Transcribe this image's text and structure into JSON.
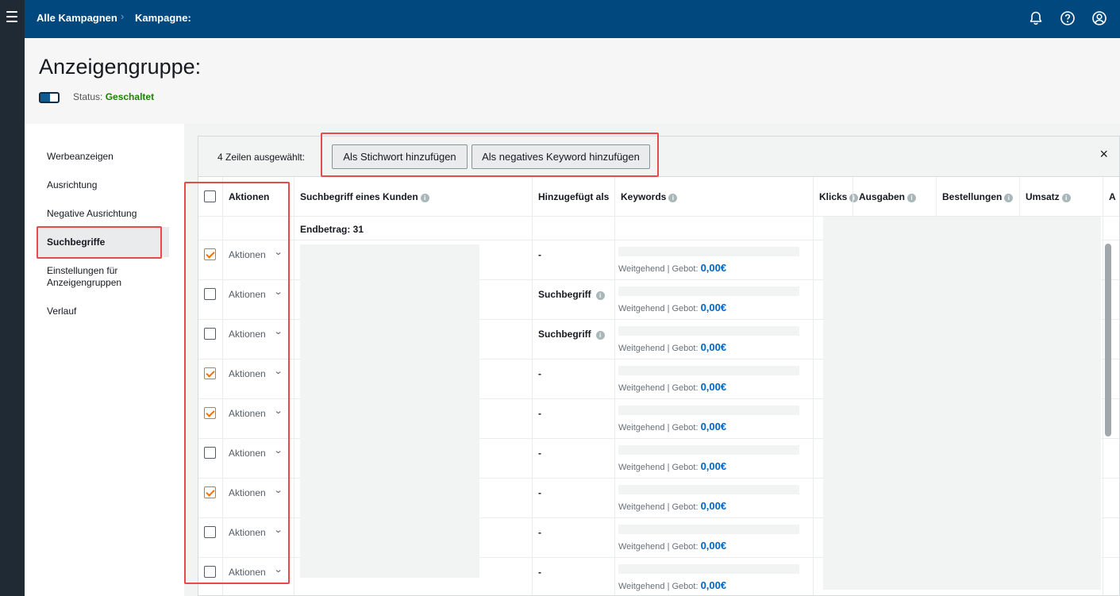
{
  "topbar": {
    "crumbs": [
      "Alle Kampagnen",
      "Kampagne:"
    ],
    "crumb_separator": "›",
    "icons": [
      "bell-icon",
      "help-icon",
      "user-icon"
    ],
    "bg_color": "#00487d"
  },
  "header": {
    "title": "Anzeigengruppe:",
    "status_label": "Status:",
    "status_value": "Geschaltet",
    "status_color": "#1d8102"
  },
  "nav": {
    "items": [
      {
        "label": "Werbeanzeigen",
        "active": false
      },
      {
        "label": "Ausrichtung",
        "active": false
      },
      {
        "label": "Negative Ausrichtung",
        "active": false
      },
      {
        "label": "Suchbegriffe",
        "active": true
      },
      {
        "label": "Einstellungen für Anzeigengruppen",
        "active": false
      },
      {
        "label": "Verlauf",
        "active": false
      }
    ]
  },
  "toolbar": {
    "selected_count": "4 Zeilen ausgewählt:",
    "add_keyword": "Als Stichwort hinzufügen",
    "add_negative": "Als negatives Keyword hinzufügen",
    "close": "×"
  },
  "table": {
    "headers": {
      "actions": "Aktionen",
      "search_term": "Suchbegriff eines Kunden",
      "added_as": "Hinzugefügt als",
      "keywords": "Keywords",
      "clicks": "Klicks",
      "spend": "Ausgaben",
      "orders": "Bestellungen",
      "sales": "Umsatz",
      "truncated": "A"
    },
    "total_label": "Endbetrag: 31",
    "rows": [
      {
        "checked": true,
        "actions": "Aktionen",
        "added_as": "-",
        "match": "Weitgehend | Gebot:",
        "bid": "0,00€"
      },
      {
        "checked": false,
        "actions": "Aktionen",
        "added_as": "Suchbegriff",
        "match": "Weitgehend | Gebot:",
        "bid": "0,00€"
      },
      {
        "checked": false,
        "actions": "Aktionen",
        "added_as": "Suchbegriff",
        "match": "Weitgehend | Gebot:",
        "bid": "0,00€"
      },
      {
        "checked": true,
        "actions": "Aktionen",
        "added_as": "-",
        "match": "Weitgehend | Gebot:",
        "bid": "0,00€"
      },
      {
        "checked": true,
        "actions": "Aktionen",
        "added_as": "-",
        "match": "Weitgehend | Gebot:",
        "bid": "0,00€"
      },
      {
        "checked": false,
        "actions": "Aktionen",
        "added_as": "-",
        "match": "Weitgehend | Gebot:",
        "bid": "0,00€"
      },
      {
        "checked": true,
        "actions": "Aktionen",
        "added_as": "-",
        "match": "Weitgehend | Gebot:",
        "bid": "0,00€"
      },
      {
        "checked": false,
        "actions": "Aktionen",
        "added_as": "-",
        "match": "Weitgehend | Gebot:",
        "bid": "0,00€"
      },
      {
        "checked": false,
        "actions": "Aktionen",
        "added_as": "-",
        "match": "Weitgehend | Gebot:",
        "bid": "0,00€"
      }
    ]
  },
  "colors": {
    "accent_checkbox": "#ec7211",
    "highlight_box": "#e8494a",
    "bid_link": "#0066c0"
  }
}
